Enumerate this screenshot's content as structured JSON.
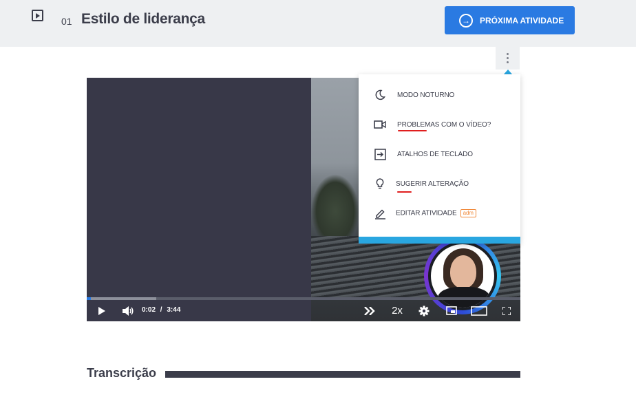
{
  "header": {
    "lesson_number": "01",
    "lesson_title": "Estilo de liderança",
    "next_button_label": "PRÓXIMA ATIVIDADE"
  },
  "video": {
    "current_time": "0:02",
    "separator": "/",
    "duration": "3:44",
    "speed": "2x",
    "progress_fraction": 0.009,
    "buffered_fraction": 0.16
  },
  "menu": {
    "items": [
      {
        "label": "MODO NOTURNO",
        "icon": "moon-icon"
      },
      {
        "label": "PROBLEMAS COM O VÍDEO?",
        "icon": "video-camera-icon"
      },
      {
        "label": "ATALHOS DE TECLADO",
        "icon": "keyboard-shortcut-icon"
      },
      {
        "label": "SUGERIR ALTERAÇÃO",
        "icon": "lightbulb-icon"
      },
      {
        "label": "EDITAR ATIVIDADE",
        "icon": "pencil-icon",
        "badge": "adm"
      }
    ]
  },
  "transcript": {
    "title": "Transcrição"
  },
  "colors": {
    "primary": "#2a7ae2",
    "menu_accent": "#29a6e0",
    "annotation_red": "#e01e1e",
    "badge_orange": "#f08a3c"
  }
}
